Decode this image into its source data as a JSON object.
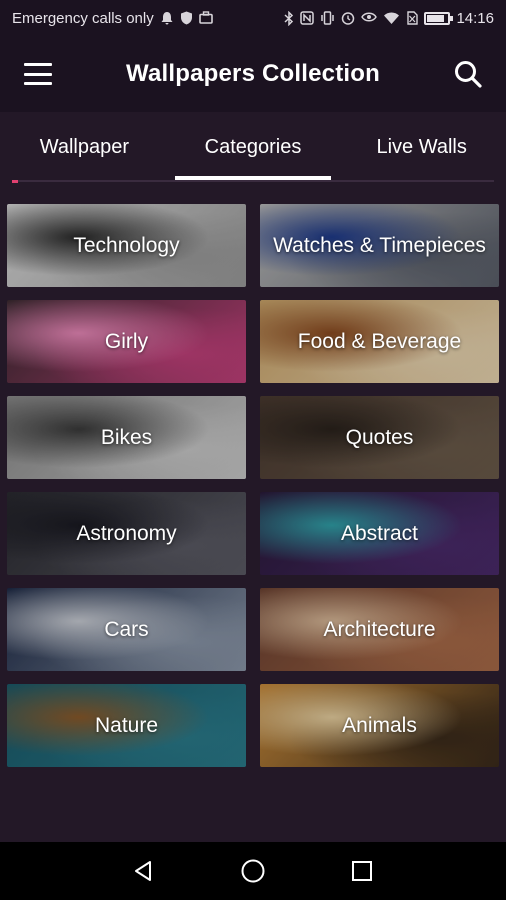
{
  "status_bar": {
    "carrier_text": "Emergency calls only",
    "time": "14:16",
    "battery_level": 0.85,
    "left_icons": [
      "bell-icon",
      "shield-icon",
      "briefcase-icon"
    ],
    "right_icons": [
      "bluetooth-icon",
      "nfc-icon",
      "vibrate-icon",
      "alarm-icon",
      "eye-icon",
      "wifi-icon",
      "no-sim-icon"
    ]
  },
  "app_bar": {
    "title": "Wallpapers Collection",
    "menu_icon": "hamburger-icon",
    "search_icon": "search-icon"
  },
  "tabs": [
    {
      "label": "Wallpaper",
      "active": false
    },
    {
      "label": "Categories",
      "active": true
    },
    {
      "label": "Live Walls",
      "active": false
    }
  ],
  "categories": [
    {
      "label": "Technology",
      "colors": [
        "#d8d8d8",
        "#9a9a9a",
        "#2a2a2a"
      ]
    },
    {
      "label": "Watches & Timepieces",
      "colors": [
        "#b9b9b9",
        "#5a5f6a",
        "#1e3a8a"
      ]
    },
    {
      "label": "Girly",
      "colors": [
        "#3a2a30",
        "#c0407a",
        "#e888b8"
      ]
    },
    {
      "label": "Food & Beverage",
      "colors": [
        "#caa46a",
        "#e8d4b0",
        "#8a4a20"
      ]
    },
    {
      "label": "Bikes",
      "colors": [
        "#8a8a8a",
        "#c8c8c8",
        "#3a3a3a"
      ]
    },
    {
      "label": "Quotes",
      "colors": [
        "#4a3a30",
        "#6a5a4a",
        "#2a221c"
      ]
    },
    {
      "label": "Astronomy",
      "colors": [
        "#2a2a30",
        "#5a5a64",
        "#1a1a22"
      ]
    },
    {
      "label": "Abstract",
      "colors": [
        "#2a1a3a",
        "#4a2a6a",
        "#30a0a8"
      ]
    },
    {
      "label": "Cars",
      "colors": [
        "#1c2844",
        "#8a96a8",
        "#c8ccd4"
      ]
    },
    {
      "label": "Architecture",
      "colors": [
        "#6a4030",
        "#a86a48",
        "#d8b898"
      ]
    },
    {
      "label": "Nature",
      "colors": [
        "#1a5a6a",
        "#2a7a8a",
        "#8a5a2a"
      ]
    },
    {
      "label": "Animals",
      "colors": [
        "#c88a3a",
        "#3a2a1a",
        "#e8d0a0"
      ]
    }
  ],
  "nav_bar": {
    "back_icon": "back-triangle-icon",
    "home_icon": "home-circle-icon",
    "recents_icon": "recents-square-icon"
  },
  "colors": {
    "app_bar_bg": "#1b1220",
    "content_bg": "#231827",
    "accent": "#e04070"
  }
}
